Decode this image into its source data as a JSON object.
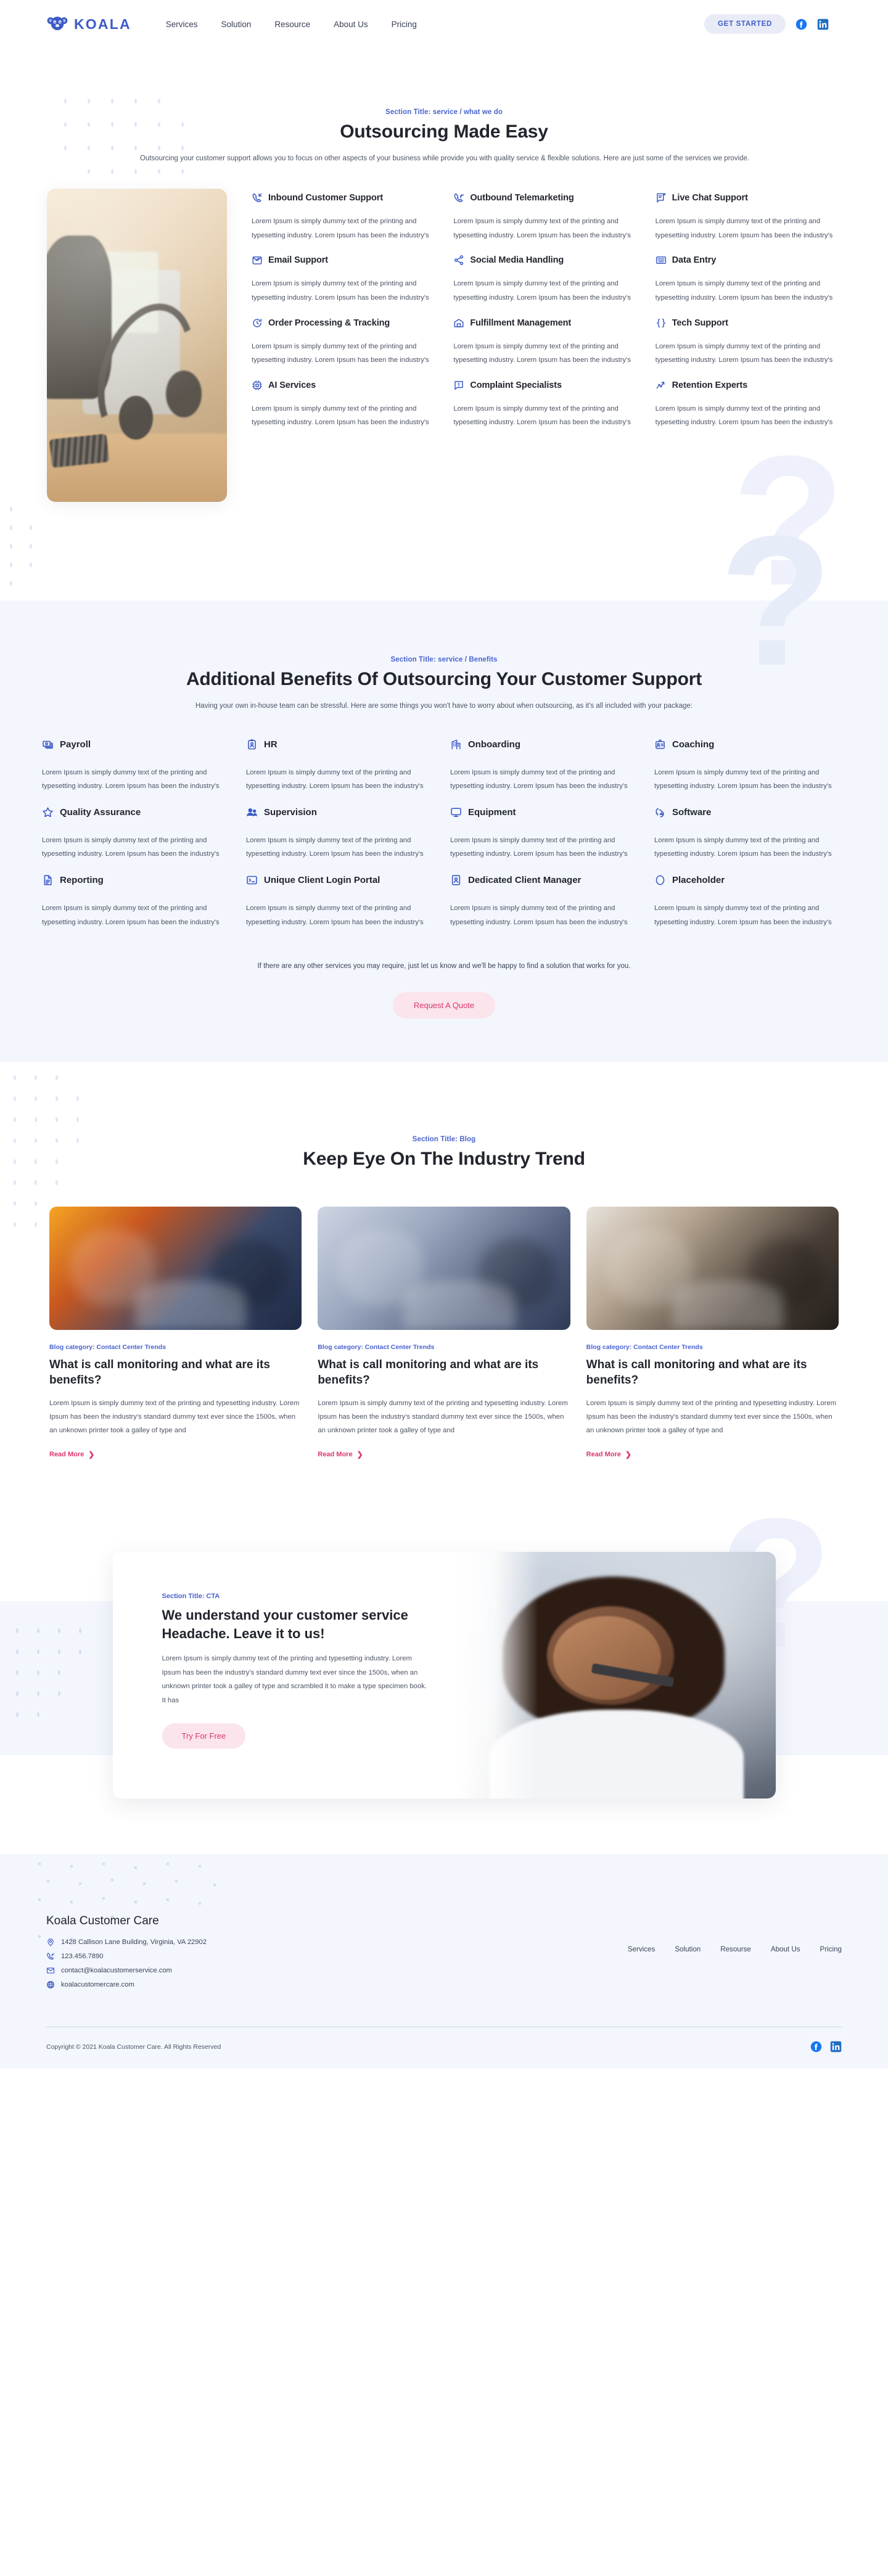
{
  "brand": {
    "name": "KOALA",
    "logo_icon": "koala-logo-icon"
  },
  "header": {
    "nav": [
      {
        "label": "Services"
      },
      {
        "label": "Solution"
      },
      {
        "label": "Resource"
      },
      {
        "label": "About Us"
      },
      {
        "label": "Pricing"
      }
    ],
    "cta_label": "GET STARTED",
    "socials": [
      {
        "name": "facebook-icon"
      },
      {
        "name": "linkedin-icon"
      }
    ]
  },
  "services": {
    "eyebrow": "Section Title: service / what we do",
    "title": "Outsourcing Made Easy",
    "subtitle": "Outsourcing your customer support allows you to focus on other aspects of your business while provide you with quality service & flexible solutions. Here are just some of the services we provide.",
    "photo_alt": "call-center-desk-phone-headset-photo",
    "items": [
      {
        "icon": "inbound-call-icon",
        "title": "Inbound Customer Support",
        "desc": "Lorem Ipsum is simply dummy text of the printing and typesetting industry. Lorem Ipsum has been the industry's"
      },
      {
        "icon": "outbound-call-icon",
        "title": "Outbound Telemarketing",
        "desc": "Lorem Ipsum is simply dummy text of the printing and typesetting industry. Lorem Ipsum has been the industry's"
      },
      {
        "icon": "chat-document-icon",
        "title": "Live Chat Support",
        "desc": "Lorem Ipsum is simply dummy text of the printing and typesetting industry. Lorem Ipsum has been the industry's"
      },
      {
        "icon": "envelope-check-icon",
        "title": "Email Support",
        "desc": "Lorem Ipsum is simply dummy text of the printing and typesetting industry. Lorem Ipsum has been the industry's"
      },
      {
        "icon": "share-network-icon",
        "title": "Social Media Handling",
        "desc": "Lorem Ipsum is simply dummy text of the printing and typesetting industry. Lorem Ipsum has been the industry's"
      },
      {
        "icon": "keyboard-icon",
        "title": "Data Entry",
        "desc": "Lorem Ipsum is simply dummy text of the printing and typesetting industry. Lorem Ipsum has been the industry's"
      },
      {
        "icon": "refresh-clock-icon",
        "title": "Order Processing & Tracking",
        "desc": "Lorem Ipsum is simply dummy text of the printing and typesetting industry. Lorem Ipsum has been the industry's"
      },
      {
        "icon": "warehouse-icon",
        "title": "Fulfillment Management",
        "desc": "Lorem Ipsum is simply dummy text of the printing and typesetting industry. Lorem Ipsum has been the industry's"
      },
      {
        "icon": "code-braces-icon",
        "title": "Tech Support",
        "desc": "Lorem Ipsum is simply dummy text of the printing and typesetting industry. Lorem Ipsum has been the industry's"
      },
      {
        "icon": "cpu-chip-icon",
        "title": "AI Services",
        "desc": "Lorem Ipsum is simply dummy text of the printing and typesetting industry. Lorem Ipsum has been the industry's"
      },
      {
        "icon": "chat-alert-icon",
        "title": "Complaint Specialists",
        "desc": "Lorem Ipsum is simply dummy text of the printing and typesetting industry. Lorem Ipsum has been the industry's"
      },
      {
        "icon": "trend-chart-icon",
        "title": "Retention Experts",
        "desc": "Lorem Ipsum is simply dummy text of the printing and typesetting industry. Lorem Ipsum has been the industry's"
      }
    ]
  },
  "benefits": {
    "eyebrow": "Section Title: service / Benefits",
    "title": "Additional Benefits Of Outsourcing Your Customer Support",
    "subtitle": "Having your own in-house team can be stressful. Here are some things you won't have to worry about when outsourcing, as it's all included with your package:",
    "items": [
      {
        "icon": "money-bills-icon",
        "title": "Payroll",
        "desc": "Lorem Ipsum is simply dummy text of the printing and typesetting industry. Lorem Ipsum has been the industry's"
      },
      {
        "icon": "id-badge-icon",
        "title": "HR",
        "desc": "Lorem Ipsum is simply dummy text of the printing and typesetting industry. Lorem Ipsum has been the industry's"
      },
      {
        "icon": "building-icon",
        "title": "Onboarding",
        "desc": "Lorem Ipsum is simply dummy text of the printing and typesetting industry. Lorem Ipsum has been the industry's"
      },
      {
        "icon": "id-card-icon",
        "title": "Coaching",
        "desc": "Lorem Ipsum is simply dummy text of the printing and typesetting industry. Lorem Ipsum has been the industry's"
      },
      {
        "icon": "star-outline-icon",
        "title": "Quality Assurance",
        "desc": "Lorem Ipsum is simply dummy text of the printing and typesetting industry. Lorem Ipsum has been the industry's"
      },
      {
        "icon": "users-icon",
        "title": "Supervision",
        "desc": "Lorem Ipsum is simply dummy text of the printing and typesetting industry. Lorem Ipsum has been the industry's"
      },
      {
        "icon": "monitor-icon",
        "title": "Equipment",
        "desc": "Lorem Ipsum is simply dummy text of the printing and typesetting industry. Lorem Ipsum has been the industry's"
      },
      {
        "icon": "cloud-sync-icon",
        "title": "Software",
        "desc": "Lorem Ipsum is simply dummy text of the printing and typesetting industry. Lorem Ipsum has been the industry's"
      },
      {
        "icon": "document-lines-icon",
        "title": "Reporting",
        "desc": "Lorem Ipsum is simply dummy text of the printing and typesetting industry. Lorem Ipsum has been the industry's"
      },
      {
        "icon": "terminal-icon",
        "title": "Unique Client Login Portal",
        "desc": "Lorem Ipsum is simply dummy text of the printing and typesetting industry. Lorem Ipsum has been the industry's"
      },
      {
        "icon": "person-card-icon",
        "title": "Dedicated Client Manager",
        "desc": "Lorem Ipsum is simply dummy text of the printing and typesetting industry. Lorem Ipsum has been the industry's"
      },
      {
        "icon": "circle-outline-icon",
        "title": "Placeholder",
        "desc": "Lorem Ipsum is simply dummy text of the printing and typesetting industry. Lorem Ipsum has been the industry's"
      }
    ],
    "note": "If there are any other services you may require, just let us know and we'll be happy to find a solution that works for you.",
    "cta_label": "Request A Quote"
  },
  "blog": {
    "eyebrow": "Section Title: Blog",
    "title": "Keep Eye On The Industry Trend",
    "posts": [
      {
        "thumb": "office-team-meeting-photo",
        "category": "Blog category: Contact Center Trends",
        "title": "What is call monitoring and what are its benefits?",
        "excerpt": "Lorem Ipsum is simply dummy text of the printing and typesetting industry. Lorem Ipsum has been the industry's standard dummy text ever since the 1500s, when an unknown printer took a galley of type and",
        "more_label": "Read More"
      },
      {
        "thumb": "two-colleagues-with-tablet-photo",
        "category": "Blog category: Contact Center Trends",
        "title": "What is call monitoring and what are its benefits?",
        "excerpt": "Lorem Ipsum is simply dummy text of the printing and typesetting industry. Lorem Ipsum has been the industry's standard dummy text ever since the 1500s, when an unknown printer took a galley of type and",
        "more_label": "Read More"
      },
      {
        "thumb": "woman-with-phone-at-cafe-photo",
        "category": "Blog category: Contact Center Trends",
        "title": "What is call monitoring and what are its benefits?",
        "excerpt": "Lorem Ipsum is simply dummy text of the printing and typesetting industry. Lorem Ipsum has been the industry's standard dummy text ever since the 1500s, when an unknown printer took a galley of type and",
        "more_label": "Read More"
      }
    ]
  },
  "cta": {
    "eyebrow": "Section Title: CTA",
    "title": "We understand your customer service Headache. Leave it to us!",
    "desc": "Lorem Ipsum is simply dummy text of the printing and typesetting industry. Lorem Ipsum has been the industry's standard dummy text ever since the 1500s, when an unknown printer took a galley of type and scrambled it to make a type specimen book. It has",
    "button_label": "Try For Free",
    "photo_alt": "smiling-call-center-agent-with-headset-photo"
  },
  "footer": {
    "company": "Koala Customer Care",
    "contacts": [
      {
        "icon": "location-pin-icon",
        "text": "1428 Callison Lane Building, Virginia, VA 22902"
      },
      {
        "icon": "phone-icon",
        "text": "123.456.7890"
      },
      {
        "icon": "envelope-icon",
        "text": "contact@koalacustomerservice.com"
      },
      {
        "icon": "globe-icon",
        "text": "koalacustomercare.com"
      }
    ],
    "nav": [
      {
        "label": "Services"
      },
      {
        "label": "Solution"
      },
      {
        "label": "Resourse"
      },
      {
        "label": "About Us"
      },
      {
        "label": "Pricing"
      }
    ],
    "copyright": "Copyright © 2021 Koala Customer Care. All Rights Reserved",
    "socials": [
      {
        "name": "facebook-icon"
      },
      {
        "name": "linkedin-icon"
      }
    ]
  },
  "colors": {
    "brand_blue": "#3d5bc6",
    "accent_pink": "#d9376e",
    "pink_soft": "#fbe4ec",
    "section_bg": "#f3f6fd",
    "text_dark": "#22252e",
    "text_body": "#4d5364"
  }
}
